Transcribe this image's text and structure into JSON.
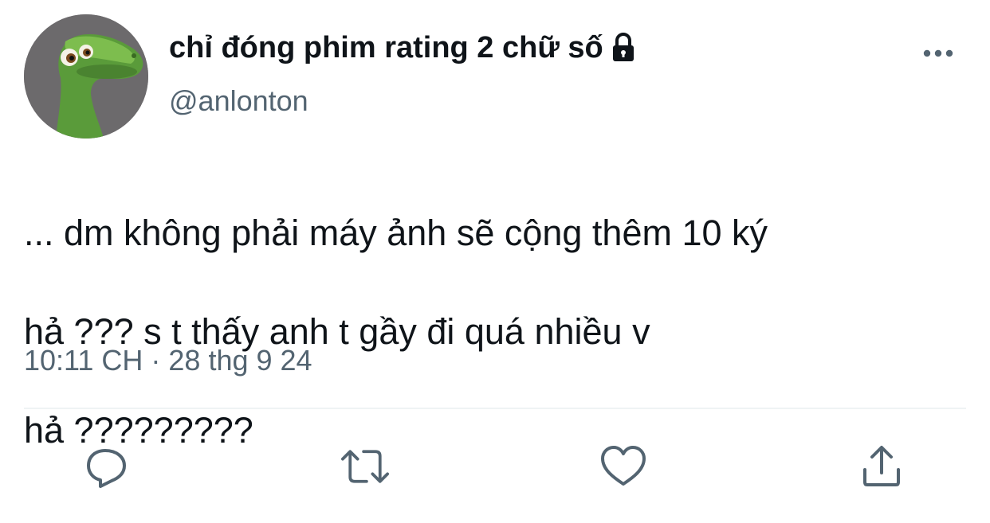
{
  "tweet": {
    "display_name": "chỉ đóng phim rating 2 chữ số",
    "handle": "@anlonton",
    "text_lines": [
      "... dm không phải máy ảnh sẽ cộng thêm 10 ký",
      "hả ??? s t thấy anh t gầy đi quá nhiều v",
      "hả ?????????"
    ],
    "timestamp": "10:11 CH · 28 thg 9 24"
  },
  "icons": {
    "avatar": "green-dinosaur-avatar",
    "lock": "lock-icon",
    "more": "more-dots-icon",
    "reply": "reply-icon",
    "retweet": "retweet-icon",
    "like": "heart-icon",
    "share": "share-icon"
  },
  "colors": {
    "text": "#0f1419",
    "secondary_text": "#536471",
    "icon": "#536471",
    "divider": "#eff3f4",
    "background": "#ffffff"
  }
}
